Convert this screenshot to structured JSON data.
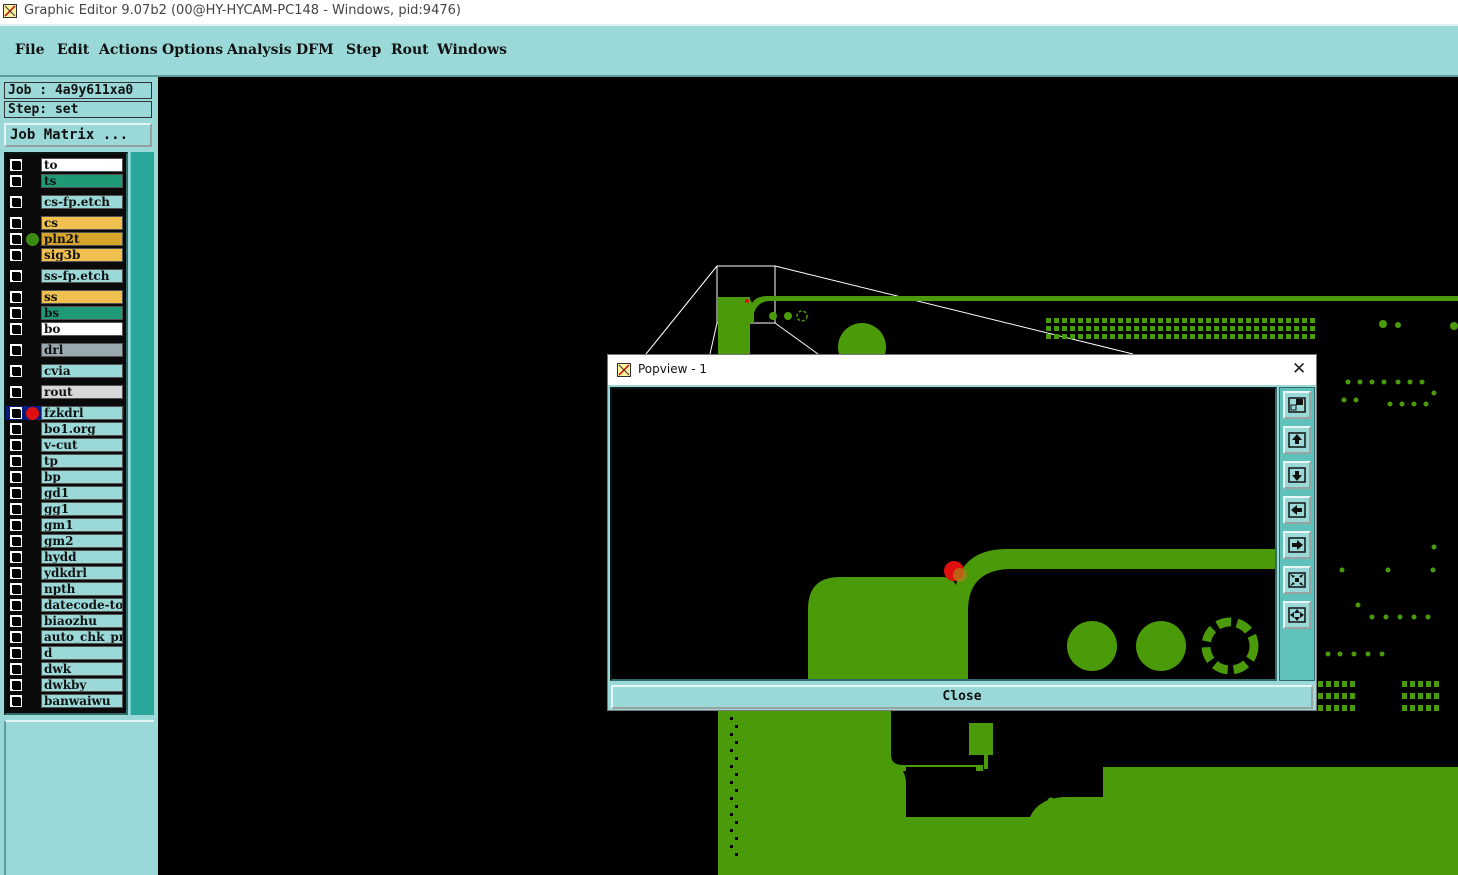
{
  "window": {
    "title": "Graphic Editor 9.07b2 (00@HY-HYCAM-PC148 - Windows, pid:9476)"
  },
  "menu": {
    "items": [
      "File",
      "Edit",
      "Actions",
      "Options",
      "Analysis",
      "DFM",
      "Step",
      "Rout",
      "Windows"
    ]
  },
  "job": {
    "label": "Job : 4a9y611xa0",
    "step": "Step: set",
    "matrix_button": "Job Matrix ..."
  },
  "layers": [
    {
      "name": "to",
      "color": "#ffffff"
    },
    {
      "name": "ts",
      "color": "#1e9a77"
    },
    {
      "name": "cs-fp.etch",
      "color": "#9ad9d8"
    },
    {
      "name": "cs",
      "color": "#f0c050"
    },
    {
      "name": "pln2t",
      "color": "#d7a52a",
      "marker": "green-dot"
    },
    {
      "name": "sig3b",
      "color": "#f0c050"
    },
    {
      "name": "ss-fp.etch",
      "color": "#9ad9d8"
    },
    {
      "name": "ss",
      "color": "#f0c050"
    },
    {
      "name": "bs",
      "color": "#1e9a77"
    },
    {
      "name": "bo",
      "color": "#ffffff"
    },
    {
      "name": "drl",
      "color": "#9aa9b0"
    },
    {
      "name": "cvia",
      "color": "#9ad9d8"
    },
    {
      "name": "rout",
      "color": "#d8d8d8"
    },
    {
      "name": "fzkdrl",
      "color": "#9ad9d8",
      "marker": "red-dot",
      "active": true
    },
    {
      "name": "bo1.org",
      "color": "#9ad9d8"
    },
    {
      "name": "v-cut",
      "color": "#9ad9d8"
    },
    {
      "name": "tp",
      "color": "#9ad9d8"
    },
    {
      "name": "bp",
      "color": "#9ad9d8"
    },
    {
      "name": "gd1",
      "color": "#9ad9d8"
    },
    {
      "name": "gg1",
      "color": "#9ad9d8"
    },
    {
      "name": "gm1",
      "color": "#9ad9d8"
    },
    {
      "name": "gm2",
      "color": "#9ad9d8"
    },
    {
      "name": "hydd",
      "color": "#9ad9d8"
    },
    {
      "name": "ydkdrl",
      "color": "#9ad9d8"
    },
    {
      "name": "npth",
      "color": "#9ad9d8"
    },
    {
      "name": "datecode-to",
      "color": "#9ad9d8"
    },
    {
      "name": "biaozhu",
      "color": "#9ad9d8"
    },
    {
      "name": "auto_chk_pn",
      "color": "#9ad9d8"
    },
    {
      "name": "d",
      "color": "#9ad9d8"
    },
    {
      "name": "dwk",
      "color": "#9ad9d8"
    },
    {
      "name": "dwkby",
      "color": "#9ad9d8"
    },
    {
      "name": "banwaiwu",
      "color": "#9ad9d8"
    }
  ],
  "popview": {
    "title": "Popview - 1",
    "close_label": "Close",
    "tool_icons": [
      "zoom-window-icon",
      "pan-up-icon",
      "pan-down-icon",
      "pan-left-icon",
      "pan-right-icon",
      "zoom-out-icon",
      "zoom-in-icon"
    ]
  },
  "colors": {
    "copper": "#4a9a0a",
    "panel": "#9ad9d8",
    "highlight": "#e01010",
    "active_layer": "#0a1a7a"
  }
}
